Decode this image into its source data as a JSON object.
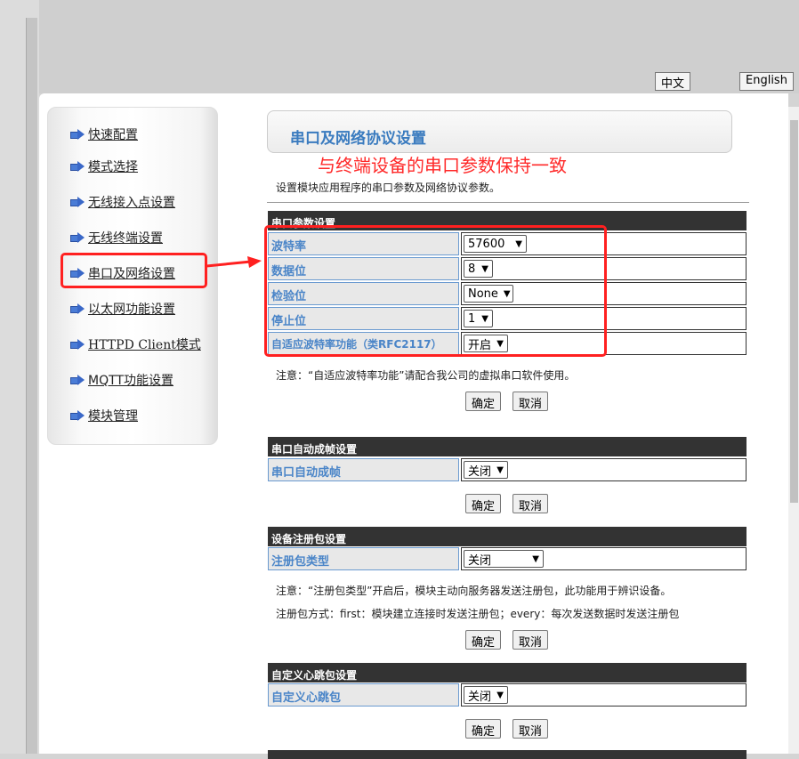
{
  "lang": {
    "zh": "中文",
    "en": "English"
  },
  "sidebar": {
    "items": [
      {
        "label": "快速配置"
      },
      {
        "label": "模式选择"
      },
      {
        "label": "无线接入点设置"
      },
      {
        "label": "无线终端设置"
      },
      {
        "label": "串口及网络设置"
      },
      {
        "label": "以太网功能设置"
      },
      {
        "label": "HTTPD Client模式"
      },
      {
        "label": "MQTT功能设置"
      },
      {
        "label": "模块管理"
      }
    ]
  },
  "title": "串口及网络协议设置",
  "annotation": "与终端设备的串口参数保持一致",
  "description": "设置模块应用程序的串口参数及网络协议参数。",
  "buttons": {
    "ok": "确定",
    "cancel": "取消"
  },
  "serial": {
    "header": "串口参数设置",
    "rows": [
      {
        "label": "波特率",
        "value": "57600"
      },
      {
        "label": "数据位",
        "value": "8"
      },
      {
        "label": "检验位",
        "value": "None"
      },
      {
        "label": "停止位",
        "value": "1"
      },
      {
        "label": "自适应波特率功能（类RFC2117）",
        "value": "开启"
      }
    ],
    "note": "注意：“自适应波特率功能”请配合我公司的虚拟串口软件使用。"
  },
  "frame": {
    "header": "串口自动成帧设置",
    "label": "串口自动成帧",
    "value": "关闭"
  },
  "register": {
    "header": "设备注册包设置",
    "label": "注册包类型",
    "value": "关闭",
    "note1": "注意：“注册包类型”开启后，模块主动向服务器发送注册包，此功能用于辨识设备。",
    "note2": "注册包方式：first：模块建立连接时发送注册包；every：每次发送数据时发送注册包"
  },
  "heartbeat": {
    "header": "自定义心跳包设置",
    "label": "自定义心跳包",
    "value": "关闭"
  }
}
